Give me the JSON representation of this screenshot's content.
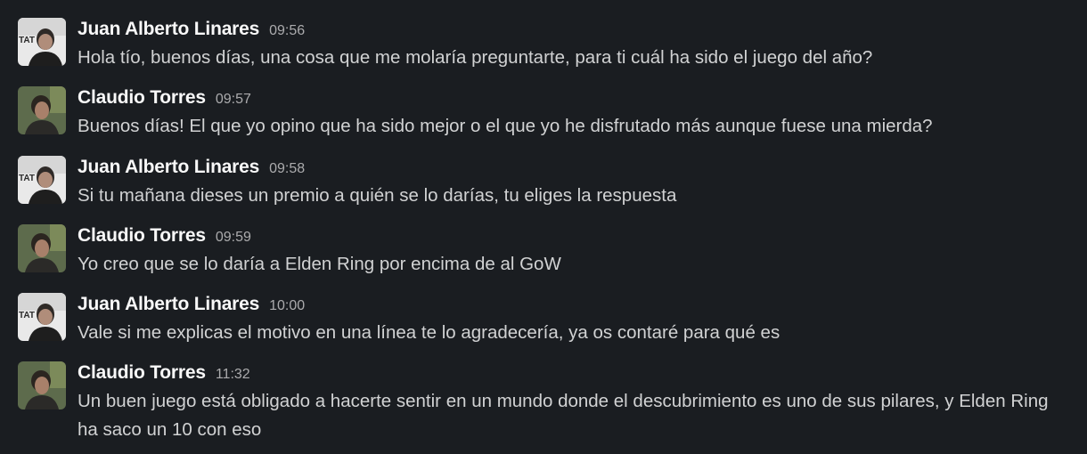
{
  "messages": [
    {
      "author": "Juan Alberto Linares",
      "time": "09:56",
      "text": "Hola tío, buenos días, una cosa que me molaría preguntarte, para ti cuál ha sido el juego del año?",
      "avatar": "juan"
    },
    {
      "author": "Claudio Torres",
      "time": "09:57",
      "text": "Buenos días! El que yo opino que ha sido mejor o el que yo he disfrutado más aunque fuese una mierda?",
      "avatar": "claudio"
    },
    {
      "author": "Juan Alberto Linares",
      "time": "09:58",
      "text": "Si tu mañana dieses un premio a quién se lo darías, tu eliges la respuesta",
      "avatar": "juan"
    },
    {
      "author": "Claudio Torres",
      "time": "09:59",
      "text": "Yo creo que se lo daría a Elden Ring por encima de al GoW",
      "avatar": "claudio"
    },
    {
      "author": "Juan Alberto Linares",
      "time": "10:00",
      "text": "Vale si me explicas el motivo en una línea te lo agradecería, ya os contaré para qué es",
      "avatar": "juan"
    },
    {
      "author": "Claudio Torres",
      "time": "11:32",
      "text": "Un buen juego está obligado a hacerte sentir en un mundo donde el descubrimiento es uno de sus pilares, y Elden Ring ha saco un 10 con eso",
      "avatar": "claudio"
    }
  ],
  "avatar_art": {
    "juan": {
      "badge_text": "TAT",
      "bg": "#e9e9e9",
      "accent": "#1e1e1e"
    },
    "claudio": {
      "bg": "#5d6b4c",
      "accent": "#2b2520"
    }
  }
}
